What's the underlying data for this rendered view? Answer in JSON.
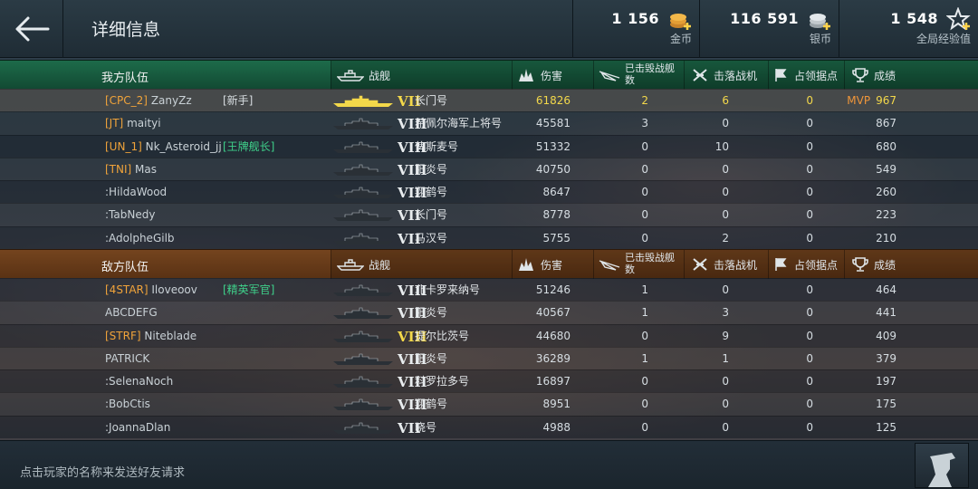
{
  "header": {
    "title": "详细信息",
    "back_icon": "back-arrow-icon",
    "currencies": [
      {
        "value": "1 156",
        "label": "金币",
        "icon": "gold-coins-icon"
      },
      {
        "value": "116 591",
        "label": "银币",
        "icon": "silver-coins-icon"
      },
      {
        "value": "1 548",
        "label": "全局经验值",
        "icon": "free-xp-star-icon"
      }
    ]
  },
  "columns": {
    "ship": "战舰",
    "damage": "伤害",
    "ships_destroyed": "已击毁战舰数",
    "planes_destroyed": "击落战机",
    "capture_points": "占领据点",
    "score": "成绩"
  },
  "allies": {
    "title": "我方队伍",
    "players": [
      {
        "clan": "[CPC_2]",
        "name": "ZanyZz",
        "tag": "[新手]",
        "tag_color": "white",
        "tier": "VII",
        "ship": "长门号",
        "damage": "61826",
        "kills": "2",
        "planes": "6",
        "caps": "0",
        "mvp": "MVP",
        "score": "967",
        "self": true
      },
      {
        "clan": "[JT]",
        "name": "maityi",
        "tag": "",
        "tier": "VIII",
        "ship": "希佩尔海军上将号",
        "damage": "45581",
        "kills": "3",
        "planes": "0",
        "caps": "0",
        "mvp": "",
        "score": "867"
      },
      {
        "clan": "[UN_1]",
        "name": "Nk_Asteroid_jj",
        "tag": "[王牌舰长]",
        "tag_color": "green",
        "tier": "VIII",
        "ship": "俾斯麦号",
        "damage": "51332",
        "kills": "0",
        "planes": "10",
        "caps": "0",
        "mvp": "",
        "score": "680"
      },
      {
        "clan": "[TNI]",
        "name": "Mas",
        "tag": "",
        "tier": "VIII",
        "ship": "阳炎号",
        "damage": "40750",
        "kills": "0",
        "planes": "0",
        "caps": "0",
        "mvp": "",
        "score": "549"
      },
      {
        "clan": "",
        "name": ":HildaWood",
        "tag": "",
        "tier": "VIII",
        "ship": "翔鹤号",
        "damage": "8647",
        "kills": "0",
        "planes": "0",
        "caps": "0",
        "mvp": "",
        "score": "260"
      },
      {
        "clan": "",
        "name": ":TabNedy",
        "tag": "",
        "tier": "VII",
        "ship": "长门号",
        "damage": "8778",
        "kills": "0",
        "planes": "0",
        "caps": "0",
        "mvp": "",
        "score": "223"
      },
      {
        "clan": "",
        "name": ":AdolpheGilb",
        "tag": "",
        "tier": "VII",
        "ship": "马汉号",
        "damage": "5755",
        "kills": "0",
        "planes": "2",
        "caps": "0",
        "mvp": "",
        "score": "210"
      }
    ]
  },
  "enemies": {
    "title": "敌方队伍",
    "players": [
      {
        "clan": "[4STAR]",
        "name": "Iloveoov",
        "tag": "[精英军官]",
        "tag_color": "green",
        "tier": "VIII",
        "ship": "北卡罗来纳号",
        "damage": "51246",
        "kills": "1",
        "planes": "0",
        "caps": "0",
        "mvp": "",
        "score": "464"
      },
      {
        "clan": "",
        "name": "ABCDEFG",
        "tag": "",
        "tier": "VIII",
        "ship": "阳炎号",
        "damage": "40567",
        "kills": "1",
        "planes": "3",
        "caps": "0",
        "mvp": "",
        "score": "441"
      },
      {
        "clan": "[STRF]",
        "name": "Niteblade",
        "tag": "",
        "tier": "VIII",
        "tier_gold": true,
        "ship": "提尔比茨号",
        "damage": "44680",
        "kills": "0",
        "planes": "9",
        "caps": "0",
        "mvp": "",
        "score": "409"
      },
      {
        "clan": "",
        "name": "PATRICK",
        "tag": "",
        "tier": "VIII",
        "ship": "阳炎号",
        "damage": "36289",
        "kills": "1",
        "planes": "1",
        "caps": "0",
        "mvp": "",
        "score": "379"
      },
      {
        "clan": "",
        "name": ":SelenaNoch",
        "tag": "",
        "tier": "VIII",
        "ship": "科罗拉多号",
        "damage": "16897",
        "kills": "0",
        "planes": "0",
        "caps": "0",
        "mvp": "",
        "score": "197"
      },
      {
        "clan": "",
        "name": ":BobCtis",
        "tag": "",
        "tier": "VIII",
        "ship": "翔鹤号",
        "damage": "8951",
        "kills": "0",
        "planes": "0",
        "caps": "0",
        "mvp": "",
        "score": "175"
      },
      {
        "clan": "",
        "name": ":JoannaDlan",
        "tag": "",
        "tier": "VII",
        "ship": "晓号",
        "damage": "4988",
        "kills": "0",
        "planes": "0",
        "caps": "0",
        "mvp": "",
        "score": "125"
      }
    ]
  },
  "footer": {
    "hint": "点击玩家的名称来发送好友请求",
    "button_icon": "captain-portrait-icon"
  },
  "colors": {
    "ally_header": "#1d6b4a",
    "enemy_header": "#74441e",
    "clan_tag": "#f0a33a",
    "green_tag": "#3fd08a",
    "highlight": "#f3d84a",
    "mvp": "#f0963a"
  }
}
